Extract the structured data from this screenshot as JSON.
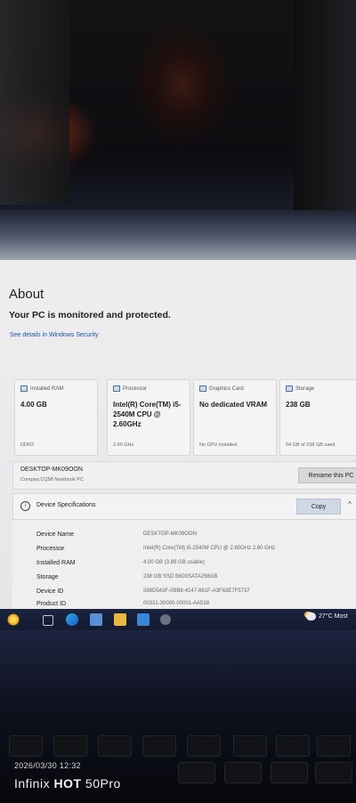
{
  "about": {
    "title": "About",
    "protection_text": "Your PC is monitored and protected.",
    "security_link": "See details in Windows Security"
  },
  "cards": [
    {
      "label": "Installed RAM",
      "value": "4.00 GB",
      "footer": "DDR3",
      "icon": "memory-icon"
    },
    {
      "label": "Processor",
      "value": "Intel(R) Core(TM) i5-2540M CPU @ 2.60GHz",
      "footer": "2.60 GHz",
      "icon": "processor-icon"
    },
    {
      "label": "Graphics Card",
      "value": "No dedicated VRAM",
      "footer": "No GPU installed",
      "icon": "graphics-card-icon"
    },
    {
      "label": "Storage",
      "value": "238 GB",
      "footer": "54 GB of 238 GB used",
      "icon": "storage-icon"
    }
  ],
  "device": {
    "name": "DESKTOP-MK09OON",
    "model": "Compaq CQ58 Notebook PC",
    "rename_label": "Rename this PC"
  },
  "specs": {
    "title": "Device Specifications",
    "copy_label": "Copy",
    "rows": [
      {
        "label": "Device Name",
        "value": "DESKTOP-MK09OON"
      },
      {
        "label": "Processor",
        "value": "Intel(R) Core(TM) i5-2540M CPU @ 2.60GHz   2.60 GHz"
      },
      {
        "label": "Installed RAM",
        "value": "4.00 GB (3.89 GB usable)"
      },
      {
        "label": "Storage",
        "value": "238 GB SSD B600SATA256GB"
      },
      {
        "label": "Device ID",
        "value": "588D543F-0BB8-4147-881F-A3F63E7F5737"
      },
      {
        "label": "Product ID",
        "value": "00331-30000-00001-AA538"
      }
    ]
  },
  "taskbar": {
    "weather": "27°C Most"
  },
  "photo_stamp": {
    "datetime": "2026/03/30 12:32",
    "brand_a": "Infinix ",
    "brand_b": "HOT",
    "brand_c": " 50Pro"
  },
  "colors": {
    "link": "#1d4f9a",
    "taskbar": "#1a2340",
    "window_bg": "#eeeeef"
  }
}
